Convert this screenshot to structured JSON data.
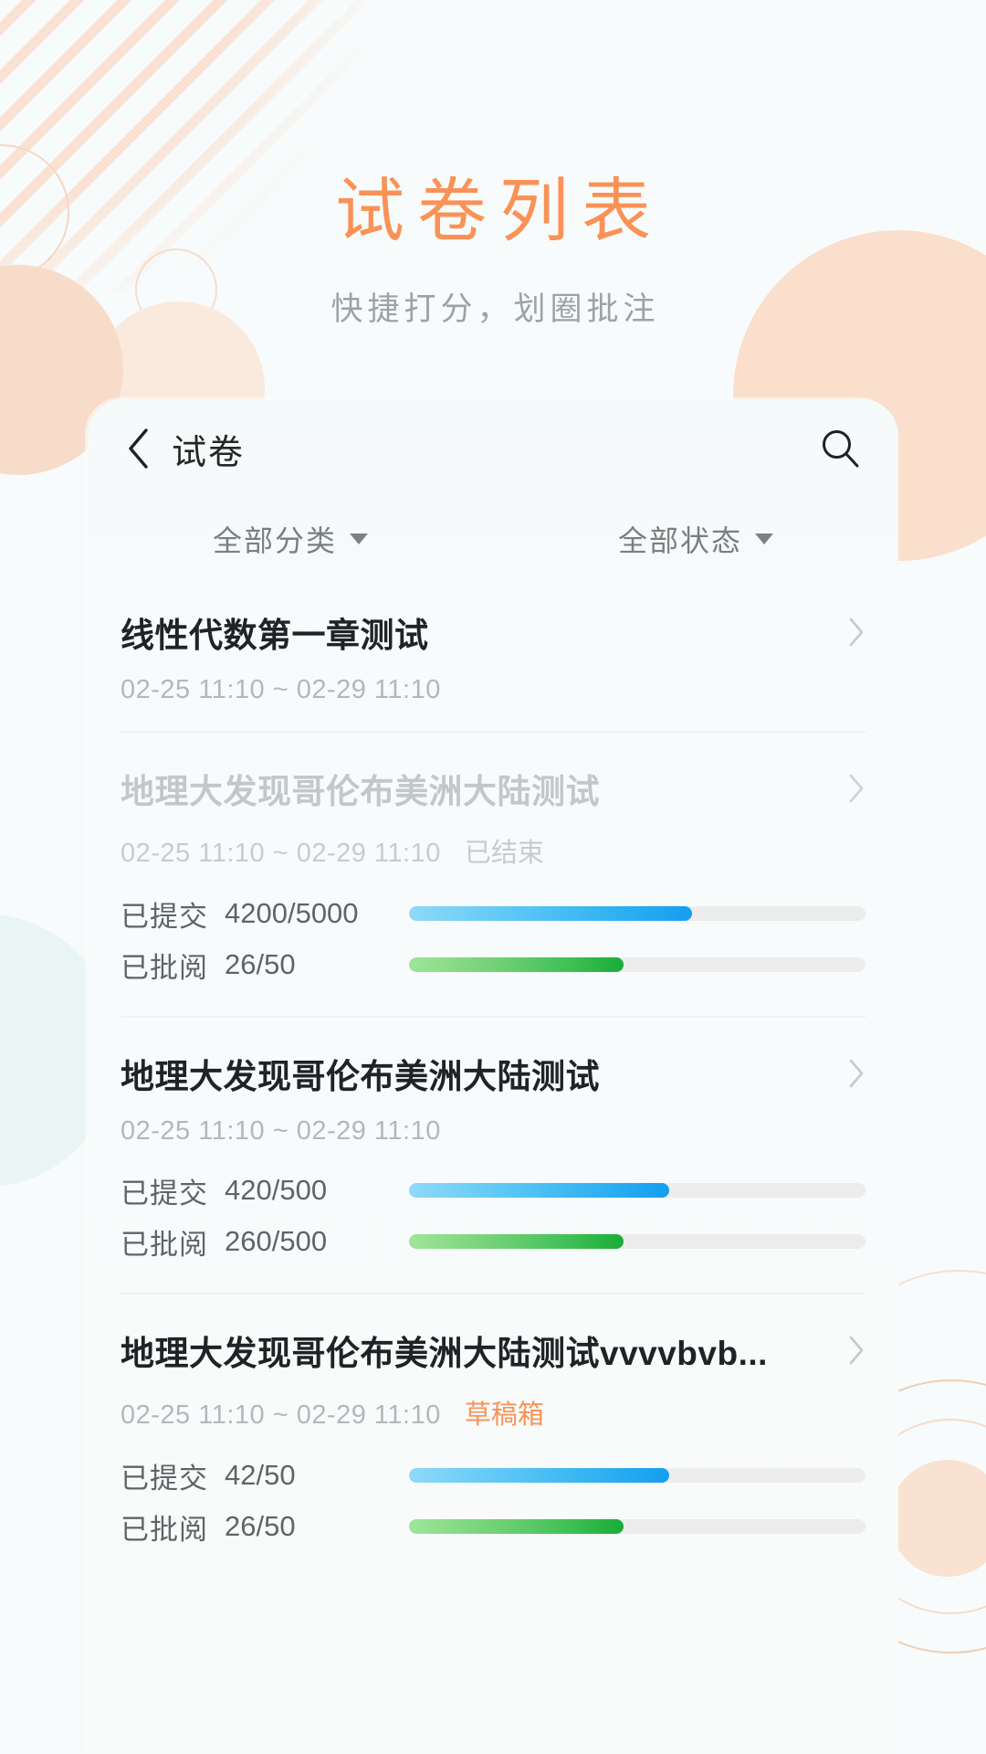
{
  "header": {
    "title": "试卷列表",
    "subtitle": "快捷打分，划圈批注",
    "title_color": "#fa9257",
    "subtitle_color": "#9ba3a6"
  },
  "navbar": {
    "back_icon": "chevron-left-icon",
    "title": "试卷",
    "search_icon": "search-icon"
  },
  "filters": {
    "category": {
      "label": "全部分类",
      "caret": "▼"
    },
    "status": {
      "label": "全部状态",
      "caret": "▼"
    }
  },
  "labels": {
    "submitted": "已提交",
    "reviewed": "已批阅",
    "chevron": "chevron-right-icon"
  },
  "colors": {
    "accent": "#fa9257",
    "submitted_bar": "#149ef0",
    "reviewed_bar": "#18ac37",
    "track": "#ecedec",
    "card_bg": "#f6fafb",
    "page_bg": "#f7fbfb"
  },
  "papers": [
    {
      "title": "线性代数第一章测试",
      "date": "02-25 11:10 ~ 02-29 11:10",
      "status": "",
      "status_type": "none",
      "dimmed": false,
      "has_progress": false,
      "submitted": {
        "label": "已提交",
        "value": "",
        "numer": 0,
        "denom": 0,
        "percent": 0
      },
      "reviewed": {
        "label": "已批阅",
        "value": "",
        "numer": 0,
        "denom": 0,
        "percent": 0
      }
    },
    {
      "title": "地理大发现哥伦布美洲大陆测试",
      "date": "02-25 11:10 ~ 02-29 11:10",
      "status": "已结束",
      "status_type": "finished",
      "dimmed": true,
      "has_progress": true,
      "submitted": {
        "label": "已提交",
        "value": "4200/5000",
        "numer": 4200,
        "denom": 5000,
        "percent": 62
      },
      "reviewed": {
        "label": "已批阅",
        "value": "26/50",
        "numer": 26,
        "denom": 50,
        "percent": 47
      }
    },
    {
      "title": "地理大发现哥伦布美洲大陆测试",
      "date": "02-25 11:10 ~ 02-29 11:10",
      "status": "",
      "status_type": "none",
      "dimmed": false,
      "has_progress": true,
      "submitted": {
        "label": "已提交",
        "value": "420/500",
        "numer": 420,
        "denom": 500,
        "percent": 57
      },
      "reviewed": {
        "label": "已批阅",
        "value": "260/500",
        "numer": 260,
        "denom": 500,
        "percent": 47
      }
    },
    {
      "title": "地理大发现哥伦布美洲大陆测试vvvvbvb...",
      "date": "02-25 11:10 ~ 02-29 11:10",
      "status": "草稿箱",
      "status_type": "draft",
      "dimmed": false,
      "has_progress": true,
      "submitted": {
        "label": "已提交",
        "value": "42/50",
        "numer": 42,
        "denom": 50,
        "percent": 57
      },
      "reviewed": {
        "label": "已批阅",
        "value": "26/50",
        "numer": 26,
        "denom": 50,
        "percent": 47
      }
    }
  ]
}
